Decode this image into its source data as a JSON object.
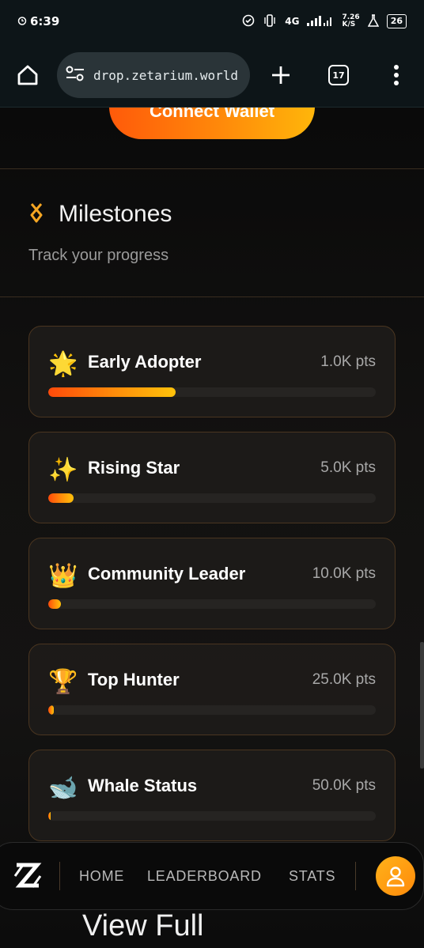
{
  "status_bar": {
    "time": "6:39",
    "network_label": "4G",
    "speed_value": "7.26",
    "speed_unit": "K/S",
    "battery": "26"
  },
  "browser": {
    "url": "drop.zetarium.world",
    "tab_count": "17"
  },
  "hero": {
    "connect_label": "Connect Wallet"
  },
  "milestones": {
    "title": "Milestones",
    "subtitle": "Track your progress",
    "items": [
      {
        "emoji": "🌟",
        "name": "Early Adopter",
        "points": "1.0K pts",
        "progress": 0.39
      },
      {
        "emoji": "✨",
        "name": "Rising Star",
        "points": "5.0K pts",
        "progress": 0.078
      },
      {
        "emoji": "👑",
        "name": "Community Leader",
        "points": "10.0K pts",
        "progress": 0.039
      },
      {
        "emoji": "🏆",
        "name": "Top Hunter",
        "points": "25.0K pts",
        "progress": 0.016
      },
      {
        "emoji": "🐋",
        "name": "Whale Status",
        "points": "50.0K pts",
        "progress": 0.008
      }
    ]
  },
  "nav": {
    "logo_text": "Z",
    "home": "HOME",
    "leaderboard": "LEADERBOARD",
    "stats": "STATS"
  },
  "footer": {
    "view_full": "View Full"
  },
  "colors": {
    "accent_start": "#ff4a0a",
    "accent_end": "#ffc20a",
    "card_border": "#4a3520"
  }
}
